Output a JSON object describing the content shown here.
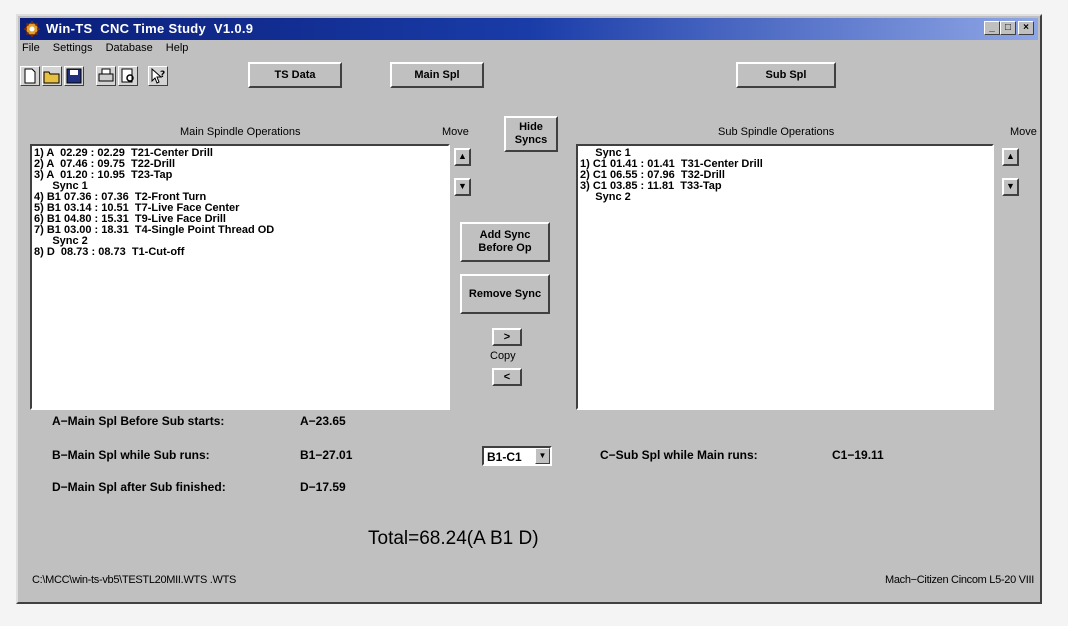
{
  "window": {
    "title": "Win-TS  CNC Time Study  V1.0.9",
    "caption_buttons": [
      "_",
      "□",
      "×"
    ]
  },
  "menu": [
    "File",
    "Settings",
    "Database",
    "Help"
  ],
  "toolbar": {
    "icons": [
      "new-file-icon",
      "open-folder-icon",
      "save-disk-icon",
      "print-icon",
      "print-preview-icon",
      "help-pointer-icon"
    ],
    "ts_data_label": "TS Data",
    "main_spl_label": "Main Spl",
    "sub_spl_label": "Sub Spl"
  },
  "main_ops": {
    "header": "Main Spindle Operations",
    "move_label": "Move",
    "items": [
      "1) A  02.29 : 02.29  T21-Center Drill",
      "2) A  07.46 : 09.75  T22-Drill",
      "3) A  01.20 : 10.95  T23-Tap",
      "      Sync 1",
      "4) B1 07.36 : 07.36  T2-Front Turn",
      "5) B1 03.14 : 10.51  T7-Live Face Center",
      "6) B1 04.80 : 15.31  T9-Live Face Drill",
      "7) B1 03.00 : 18.31  T4-Single Point Thread OD",
      "      Sync 2",
      "8) D  08.73 : 08.73  T1-Cut-off"
    ]
  },
  "sub_ops": {
    "header": "Sub Spindle Operations",
    "move_label": "Move",
    "items": [
      "     Sync 1",
      "1) C1 01.41 : 01.41  T31-Center Drill",
      "2) C1 06.55 : 07.96  T32-Drill",
      "3) C1 03.85 : 11.81  T33-Tap",
      "     Sync 2"
    ]
  },
  "center_buttons": {
    "hide_syncs": "Hide Syncs",
    "add_sync": "Add Sync Before Op",
    "remove_sync": "Remove Sync",
    "copy_right": ">",
    "copy_label": "Copy",
    "copy_left": "<"
  },
  "summary": {
    "a_label": "A−Main Spl Before Sub starts:",
    "a_value": "A−23.65",
    "b_label": "B−Main Spl while Sub runs:",
    "b_value": "B1−27.01",
    "d_label": "D−Main Spl after Sub finished:",
    "d_value": "D−17.59",
    "c_label": "C−Sub Spl while Main runs:",
    "c_value": "C1−19.11",
    "dropdown_value": "B1-C1",
    "total": "Total=68.24(A B1 D)"
  },
  "status": {
    "path": "C:\\MCC\\win-ts-vb5\\TESTL20MII.WTS .WTS",
    "machine": "Mach−Citizen Cincom L5-20 VIII"
  },
  "colors": {
    "title_start": "#0a1e7a",
    "title_end": "#8fa6e6",
    "face": "#c0c0c0"
  }
}
